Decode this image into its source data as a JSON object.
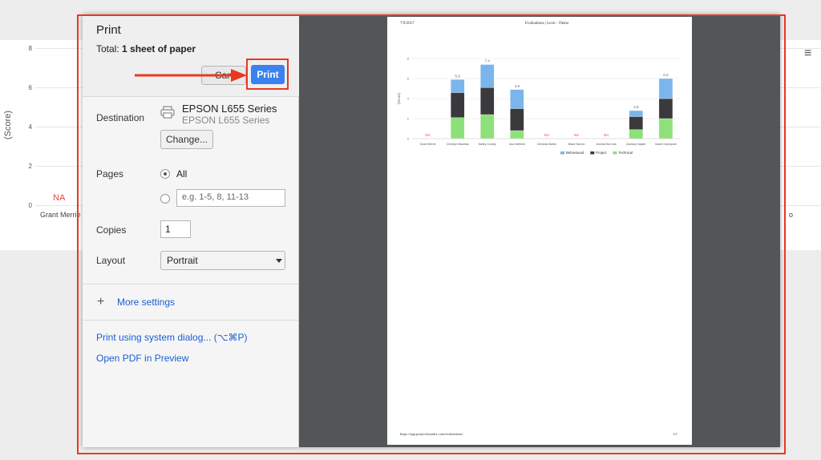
{
  "background": {
    "yaxis_label": "(Score)",
    "ticks": [
      "8",
      "6",
      "4",
      "2",
      "0"
    ],
    "na_label": "NA",
    "first_category": "Grant Merrie",
    "trailing_text": "o",
    "menu_icon": "hamburger-menu-icon"
  },
  "dialog": {
    "title": "Print",
    "total_prefix": "Total:",
    "total_value": "1 sheet of paper",
    "cancel_label": "Can",
    "print_label": "Print",
    "destination_label": "Destination",
    "printer_name": "EPSON L655 Series",
    "printer_sub": "EPSON L655 Series",
    "change_label": "Change...",
    "pages_label": "Pages",
    "pages_all": "All",
    "pages_placeholder": "e.g. 1-5, 8, 11-13",
    "copies_label": "Copies",
    "copies_value": "1",
    "layout_label": "Layout",
    "layout_value": "Portrait",
    "more_settings_icon": "+",
    "more_settings": "More settings",
    "system_dialog": "Print using system dialog... (⌥⌘P)",
    "open_pdf": "Open PDF in Preview"
  },
  "preview": {
    "date": "7/9/2017",
    "header_title": "Evaluations | Lexir - Demo",
    "footer_url": "https://app.projectfoundry.com/evaluations/",
    "footer_page": "1/1"
  },
  "chart_data": {
    "type": "bar",
    "stacked": true,
    "ylabel": "(Score)",
    "ylim": [
      0,
      8
    ],
    "yticks": [
      0,
      2,
      4,
      6,
      8
    ],
    "categories": [
      "Grant Merrie",
      "Christlyn Bautista",
      "Kailey Crosby",
      "Ava Welfield",
      "Christian Butler",
      "Blake Norton",
      "Amelia McClure",
      "Zachary Napier",
      "Isabel Catchpole"
    ],
    "series": [
      {
        "name": "Technical",
        "color": "#8ee07a",
        "values": [
          0,
          2.1,
          2.4,
          0.8,
          0,
          0,
          0,
          0.9,
          2.0
        ]
      },
      {
        "name": "Project",
        "color": "#3a3a3c",
        "values": [
          0,
          2.5,
          2.7,
          2.2,
          0,
          0,
          0,
          1.3,
          2.0
        ]
      },
      {
        "name": "Behavioural",
        "color": "#7cb5ec",
        "values": [
          0,
          1.3,
          2.3,
          1.9,
          0,
          0,
          0,
          0.6,
          2.0
        ]
      }
    ],
    "totals": [
      "NA",
      "5.9",
      "7.4",
      "4.9",
      "NA",
      "NA",
      "NA",
      "2.8",
      "6.0"
    ],
    "legend": [
      "Behavioural",
      "Project",
      "Technical"
    ],
    "legend_position": "bottom"
  }
}
